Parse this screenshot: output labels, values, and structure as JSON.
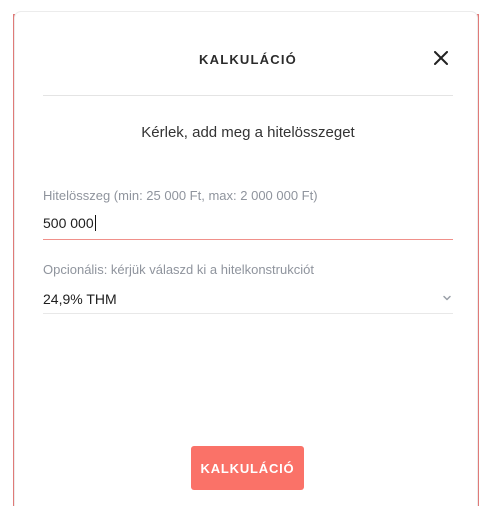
{
  "modal": {
    "title": "KALKULÁCIÓ",
    "subtitle": "Kérlek, add meg a hitelösszeget"
  },
  "amount_field": {
    "label": "Hitelösszeg (min: 25 000 Ft, max: 2 000 000 Ft)",
    "value": "500 000"
  },
  "construction_field": {
    "label": "Opcionális: kérjük válaszd ki a hitelkonstrukciót",
    "selected": "24,9% THM"
  },
  "submit_button": {
    "label": "KALKULÁCIÓ"
  },
  "colors": {
    "accent": "#fa7268",
    "chevron": "#9aa0a8",
    "backdrop_edge": "#e07a78"
  },
  "icons": {
    "close": "close-icon",
    "dropdown": "chevron-down-icon"
  }
}
